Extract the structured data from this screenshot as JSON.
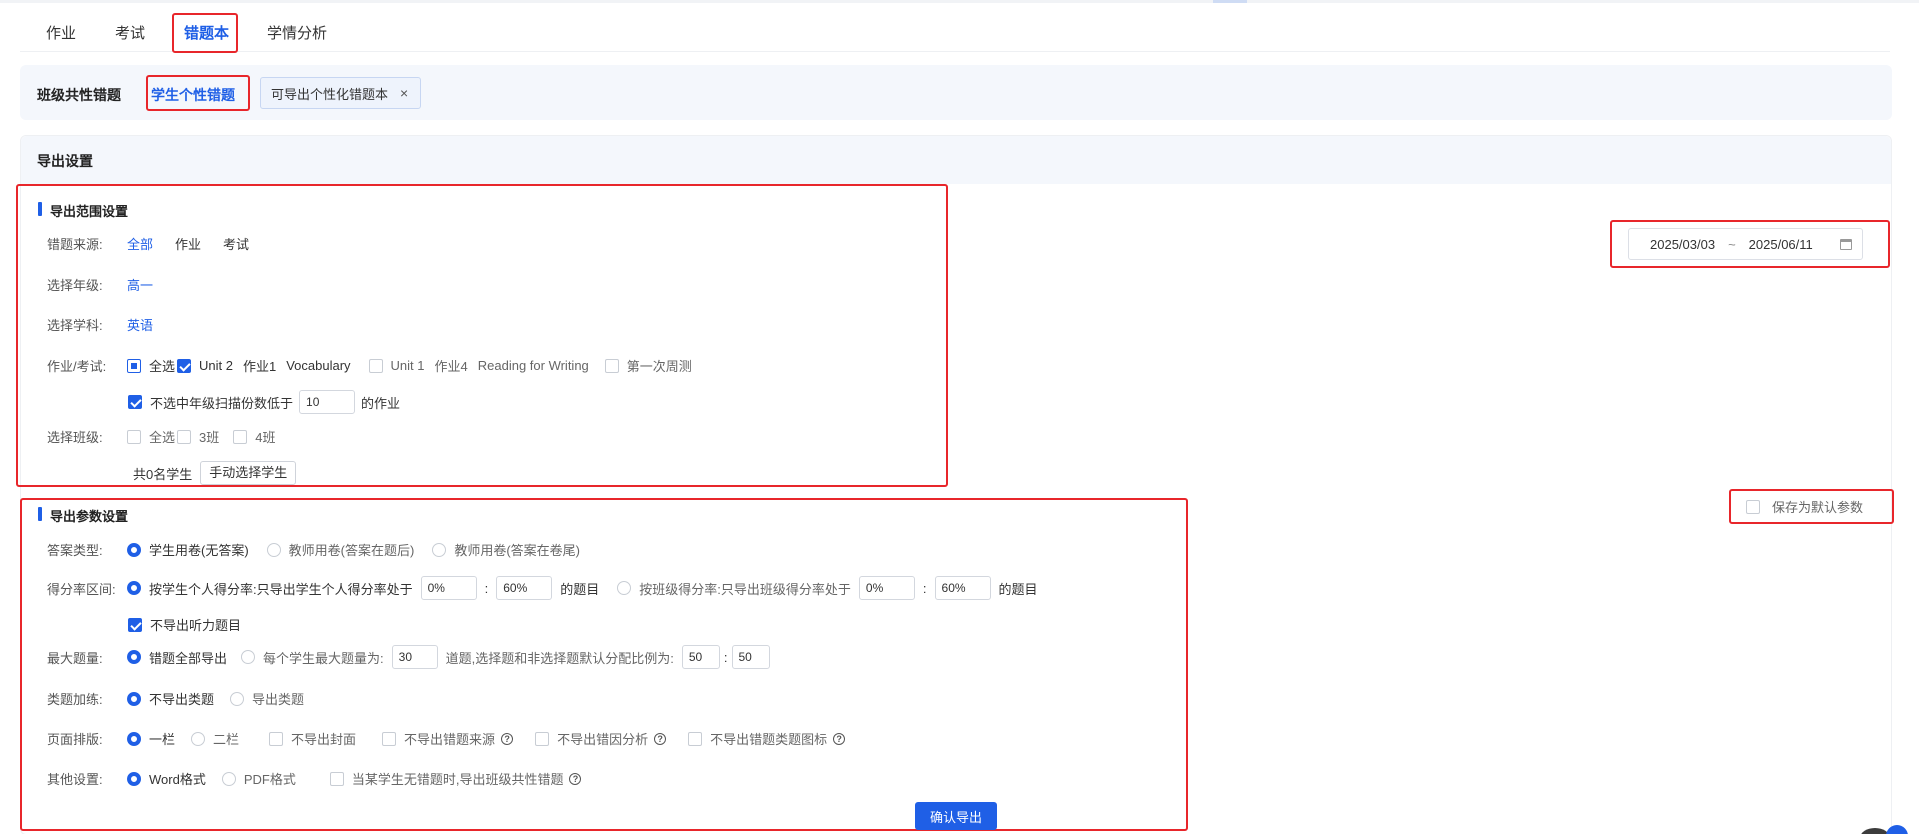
{
  "tabs": [
    {
      "label": "作业",
      "active": false
    },
    {
      "label": "考试",
      "active": false
    },
    {
      "label": "错题本",
      "active": true
    },
    {
      "label": "学情分析",
      "active": false
    }
  ],
  "subtabs": {
    "common": "班级共性错题",
    "personal": "学生个性错题",
    "chip": "可导出个性化错题本",
    "chip_close": "×"
  },
  "export": {
    "title": "导出设置",
    "range_title": "导出范围设置",
    "source": {
      "label": "错题来源:",
      "options": [
        "全部",
        "作业",
        "考试"
      ],
      "selected": "全部"
    },
    "grade": {
      "label": "选择年级:",
      "value": "高一"
    },
    "subject": {
      "label": "选择学科:",
      "value": "英语"
    },
    "homework": {
      "label": "作业/考试:",
      "select_all": "全选",
      "items": [
        "Unit 2",
        "作业1",
        "Vocabulary",
        "Unit 1",
        "作业4",
        "Reading for Writing",
        "第一次周测"
      ],
      "filter_prefix": "不选中年级扫描份数低于",
      "filter_value": "10",
      "filter_suffix": "的作业"
    },
    "class": {
      "label": "选择班级:",
      "select_all": "全选",
      "items": [
        "3班",
        "4班"
      ],
      "student_count": "共0名学生",
      "manual_select": "手动选择学生"
    },
    "date_range": {
      "start": "2025/03/03",
      "sep": "~",
      "end": "2025/06/11"
    },
    "params_title": "导出参数设置",
    "save_default": "保存为默认参数",
    "answer_type": {
      "label": "答案类型:",
      "options": [
        "学生用卷(无答案)",
        "教师用卷(答案在题后)",
        "教师用卷(答案在卷尾)"
      ]
    },
    "score_range": {
      "label": "得分率区间:",
      "personal_text": "按学生个人得分率:只导出学生个人得分率处于",
      "personal_min": "0%",
      "colon": ":",
      "personal_max": "60%",
      "personal_suffix": "的题目",
      "class_text": "按班级得分率:只导出班级得分率处于",
      "class_min": "0%",
      "class_max": "60%",
      "class_suffix": "的题目",
      "no_listening": "不导出听力题目"
    },
    "max_count": {
      "label": "最大题量:",
      "all": "错题全部导出",
      "per_student": "每个学生最大题量为:",
      "per_value": "30",
      "ratio_text": "道题,选择题和非选择题默认分配比例为:",
      "ratio_a": "50",
      "ratio_b": "50"
    },
    "category": {
      "label": "类题加练:",
      "options": [
        "不导出类题",
        "导出类题"
      ]
    },
    "layout": {
      "label": "页面排版:",
      "options": [
        "一栏",
        "二栏"
      ],
      "checks": [
        "不导出封面",
        "不导出错题来源",
        "不导出错因分析",
        "不导出错题类题图标"
      ]
    },
    "other": {
      "label": "其他设置:",
      "options": [
        "Word格式",
        "PDF格式"
      ],
      "fallback": "当某学生无错题时,导出班级共性错题"
    },
    "confirm": "确认导出"
  },
  "colors": {
    "accent": "#1f5fe6",
    "highlight_box": "#e8262b"
  }
}
